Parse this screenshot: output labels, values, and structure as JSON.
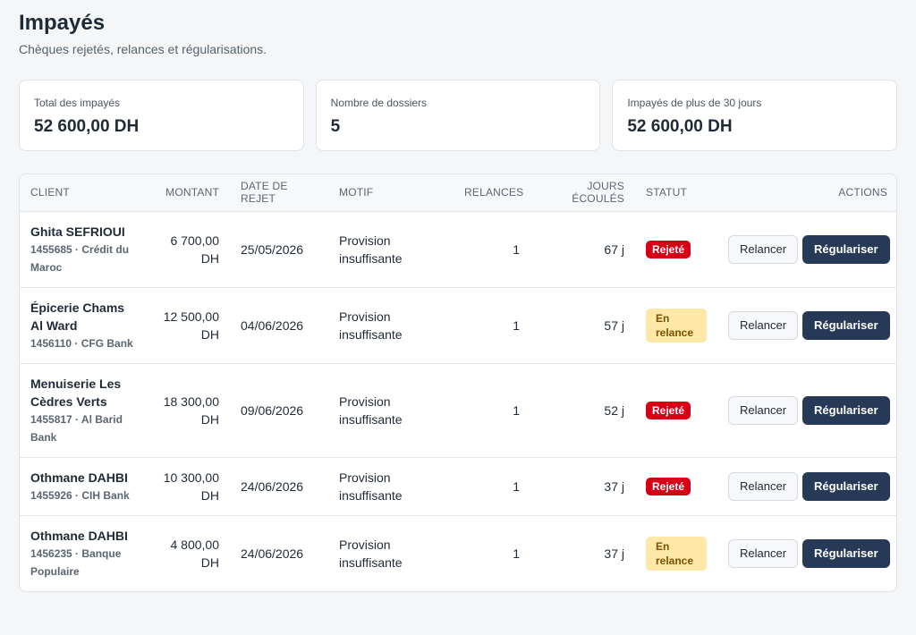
{
  "header": {
    "title": "Impayés",
    "subtitle": "Chèques rejetés, relances et régularisations."
  },
  "cards": [
    {
      "label": "Total des impayés",
      "value": "52 600,00 DH"
    },
    {
      "label": "Nombre de dossiers",
      "value": "5"
    },
    {
      "label": "Impayés de plus de 30 jours",
      "value": "52 600,00 DH"
    }
  ],
  "table": {
    "columns": {
      "client": "CLIENT",
      "montant": "MONTANT",
      "date": "DATE DE REJET",
      "motif": "MOTIF",
      "relances": "RELANCES",
      "jours": "JOURS ÉCOULÉS",
      "statut": "STATUT",
      "actions": "ACTIONS"
    },
    "rows": [
      {
        "client": "Ghita SEFRIOUI",
        "sub": "1455685 · Crédit du Maroc",
        "montant": "6 700,00 DH",
        "date": "25/05/2026",
        "motif": "Provision insuffisante",
        "relances": "1",
        "jours": "67 j",
        "statut": "Rejeté",
        "relance_label": "Relancer",
        "regulariser_label": "Régulariser"
      },
      {
        "client": "Épicerie Chams Al Ward",
        "sub": "1456110 · CFG Bank",
        "montant": "12 500,00 DH",
        "date": "04/06/2026",
        "motif": "Provision insuffisante",
        "relances": "1",
        "jours": "57 j",
        "statut": "En relance",
        "relance_label": "Relancer",
        "regulariser_label": "Régulariser"
      },
      {
        "client": "Menuiserie Les Cèdres Verts",
        "sub": "1455817 · Al Barid Bank",
        "montant": "18 300,00 DH",
        "date": "09/06/2026",
        "motif": "Provision insuffisante",
        "relances": "1",
        "jours": "52 j",
        "statut": "Rejeté",
        "relance_label": "Relancer",
        "regulariser_label": "Régulariser"
      },
      {
        "client": "Othmane DAHBI",
        "sub": "1455926 · CIH Bank",
        "montant": "10 300,00 DH",
        "date": "24/06/2026",
        "motif": "Provision insuffisante",
        "relances": "1",
        "jours": "37 j",
        "statut": "Rejeté",
        "relance_label": "Relancer",
        "regulariser_label": "Régulariser"
      },
      {
        "client": "Othmane DAHBI",
        "sub": "1456235 · Banque Populaire",
        "montant": "4 800,00 DH",
        "date": "24/06/2026",
        "motif": "Provision insuffisante",
        "relances": "1",
        "jours": "37 j",
        "statut": "En relance",
        "relance_label": "Relancer",
        "regulariser_label": "Régulariser"
      }
    ]
  },
  "colors": {
    "rejete_bg": "#d80015",
    "relance_bg": "#fde8a8",
    "primary_button": "#263a57"
  }
}
